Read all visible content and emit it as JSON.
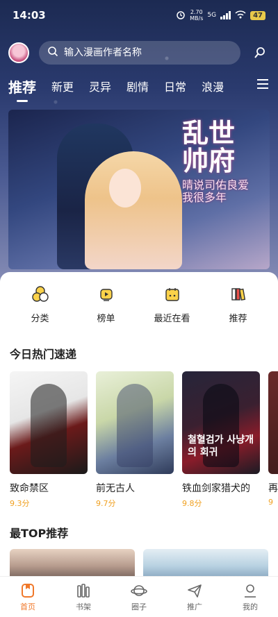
{
  "status": {
    "time": "14:03",
    "net_speed_value": "2.70",
    "net_speed_unit": "MB/s",
    "network": "5G",
    "battery": "47"
  },
  "search": {
    "placeholder": "输入漫画作者名称"
  },
  "tabs": [
    {
      "label": "推荐",
      "active": true
    },
    {
      "label": "新更"
    },
    {
      "label": "灵异"
    },
    {
      "label": "剧情"
    },
    {
      "label": "日常"
    },
    {
      "label": "浪漫"
    }
  ],
  "banner": {
    "title": "乱世",
    "title2": "帅府",
    "subtitle": "晴说司佑良爱我很多年"
  },
  "quick": [
    {
      "label": "分类",
      "icon": "category-icon"
    },
    {
      "label": "榜单",
      "icon": "ranking-icon"
    },
    {
      "label": "最近在看",
      "icon": "recent-calendar-icon"
    },
    {
      "label": "推荐",
      "icon": "books-icon"
    }
  ],
  "hot": {
    "title": "今日热门速递",
    "items": [
      {
        "name": "致命禁区",
        "score": "9.3分"
      },
      {
        "name": "前无古人",
        "score": "9.7分"
      },
      {
        "name": "铁血剑家猎犬的",
        "score": "9.8分",
        "cover_text": "철혈검가 사냥개의 회귀"
      },
      {
        "name": "再",
        "score": "9"
      }
    ]
  },
  "top": {
    "title": "最TOP推荐"
  },
  "bottom_nav": [
    {
      "label": "首页",
      "active": true
    },
    {
      "label": "书架"
    },
    {
      "label": "圈子"
    },
    {
      "label": "推广"
    },
    {
      "label": "我的"
    }
  ],
  "colors": {
    "accent": "#f0782a",
    "score": "#f0a020",
    "battery": "#e8c94a"
  }
}
